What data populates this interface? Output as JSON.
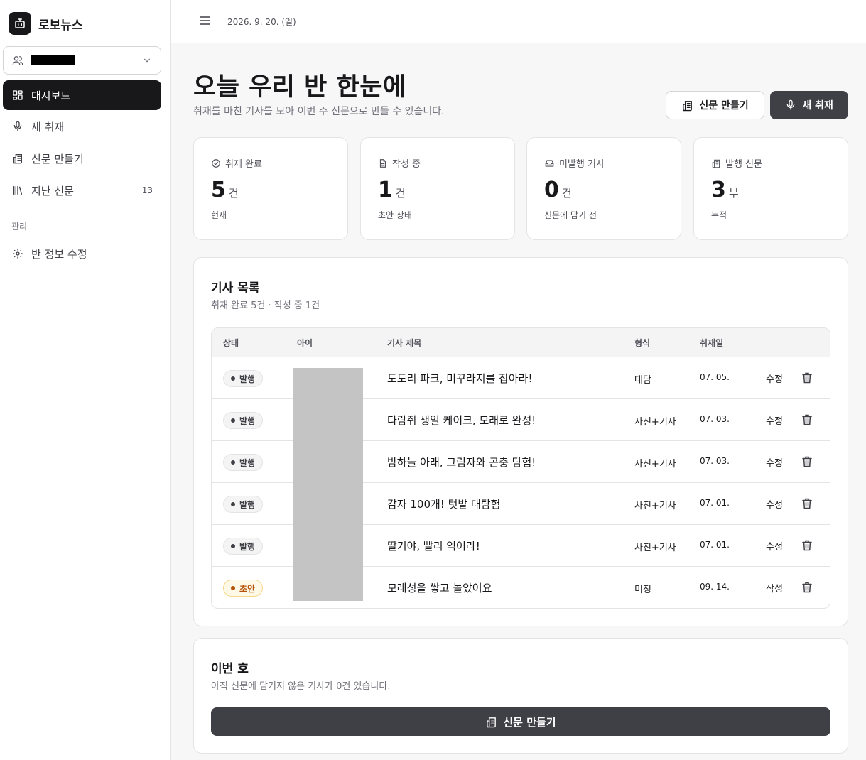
{
  "app": {
    "name": "로보뉴스",
    "date": "2026. 9. 20. (일)"
  },
  "sidebar": {
    "items": [
      {
        "label": "대시보드"
      },
      {
        "label": "새 취재"
      },
      {
        "label": "신문 만들기"
      },
      {
        "label": "지난 신문",
        "count": "13"
      }
    ],
    "section_label": "관리",
    "admin_items": [
      {
        "label": "반 정보 수정"
      }
    ]
  },
  "header": {
    "title": "오늘 우리 반 한눈에",
    "subtitle": "취재를 마친 기사를 모아 이번 주 신문으로 만들 수 있습니다.",
    "make_paper_label": "신문 만들기",
    "new_report_label": "새 취재"
  },
  "stats": [
    {
      "label": "취재 완료",
      "value": "5",
      "unit": "건",
      "note": "현재"
    },
    {
      "label": "작성 중",
      "value": "1",
      "unit": "건",
      "note": "초안 상태"
    },
    {
      "label": "미발행 기사",
      "value": "0",
      "unit": "건",
      "note": "신문에 담기 전"
    },
    {
      "label": "발행 신문",
      "value": "3",
      "unit": "부",
      "note": "누적"
    }
  ],
  "articles": {
    "title": "기사 목록",
    "subtitle": "취재 완료 5건 · 작성 중 1건",
    "columns": [
      "상태",
      "아이",
      "기사 제목",
      "형식",
      "취재일"
    ],
    "rows": [
      {
        "status": "발행",
        "title": "도도리 파크, 미꾸라지를 잡아라!",
        "type": "대담",
        "date": "07. 05.",
        "action": "수정"
      },
      {
        "status": "발행",
        "title": "다람쥐 생일 케이크, 모래로 완성!",
        "type": "사진+기사",
        "date": "07. 03.",
        "action": "수정"
      },
      {
        "status": "발행",
        "title": "밤하늘 아래, 그림자와 곤충 탐험!",
        "type": "사진+기사",
        "date": "07. 03.",
        "action": "수정"
      },
      {
        "status": "발행",
        "title": "감자 100개! 텃밭 대탐험",
        "type": "사진+기사",
        "date": "07. 01.",
        "action": "수정"
      },
      {
        "status": "발행",
        "title": "딸기야, 빨리 익어라!",
        "type": "사진+기사",
        "date": "07. 01.",
        "action": "수정"
      },
      {
        "status": "초안",
        "title": "모래성을 쌓고 놀았어요",
        "type": "미정",
        "date": "09. 14.",
        "action": "작성"
      }
    ]
  },
  "issue": {
    "title": "이번 호",
    "subtitle": "아직 신문에 담기지 않은 기사가 0건 있습니다.",
    "button_label": "신문 만들기"
  },
  "colors": {
    "primary": "#18181b",
    "button_dark": "#3f3f46",
    "draft_accent": "#b45309"
  }
}
